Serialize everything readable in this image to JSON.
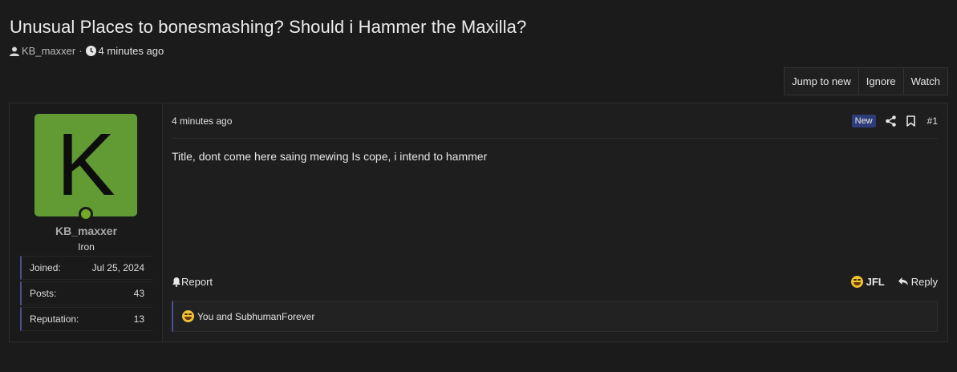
{
  "thread": {
    "title": "Unusual Places to bonesmashing? Should i Hammer the Maxilla?",
    "author": "KB_maxxer",
    "separator": "·",
    "posted": "4 minutes ago"
  },
  "actions": {
    "jump_to_new": "Jump to new",
    "ignore": "Ignore",
    "watch": "Watch"
  },
  "user": {
    "avatar_letter": "K",
    "avatar_color": "#629b34",
    "online_color": "#73a829",
    "name": "KB_maxxer",
    "title": "Iron",
    "stats": [
      {
        "label": "Joined:",
        "value": "Jul 25, 2024"
      },
      {
        "label": "Posts:",
        "value": "43"
      },
      {
        "label": "Reputation:",
        "value": "13"
      }
    ]
  },
  "post": {
    "time": "4 minutes ago",
    "badge": "New",
    "badge_color": "#2f3c7a",
    "number": "#1",
    "body": "Title, dont come here saing mewing Is cope, i intend to hammer",
    "report_label": "Report",
    "react_label": "JFL",
    "reply_label": "Reply",
    "reactions_text": "You and SubhumanForever"
  },
  "icons": {
    "author": "user-icon",
    "time": "clock-icon",
    "share": "share-icon",
    "bookmark": "bookmark-icon",
    "report": "bell-icon",
    "react": "laughing-emoji-icon",
    "reply": "reply-icon"
  }
}
